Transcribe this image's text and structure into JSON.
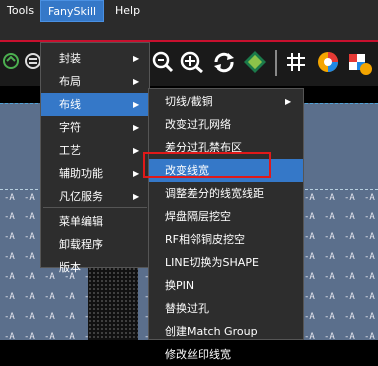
{
  "menubar": {
    "items": [
      "Tools",
      "FanySkill",
      "Help"
    ]
  },
  "menu1": {
    "items": [
      {
        "label": "封装",
        "arrow": "▶"
      },
      {
        "label": "布局",
        "arrow": "▶"
      },
      {
        "label": "布线",
        "arrow": "▶"
      },
      {
        "label": "字符",
        "arrow": "▶"
      },
      {
        "label": "工艺",
        "arrow": "▶"
      },
      {
        "label": "辅助功能",
        "arrow": "▶"
      },
      {
        "label": "凡亿服务",
        "arrow": "▶"
      },
      {
        "label": "菜单编辑",
        "arrow": ""
      },
      {
        "label": "卸载程序",
        "arrow": ""
      },
      {
        "label": "版本",
        "arrow": ""
      }
    ]
  },
  "menu2": {
    "items": [
      {
        "label": "切线/截铜",
        "arrow": "▶"
      },
      {
        "label": "改变过孔网络",
        "arrow": ""
      },
      {
        "label": "差分过孔禁布区",
        "arrow": ""
      },
      {
        "label": "改变线宽",
        "arrow": ""
      },
      {
        "label": "调整差分的线宽线距",
        "arrow": ""
      },
      {
        "label": "焊盘隔层挖空",
        "arrow": ""
      },
      {
        "label": "RF相邻铜皮挖空",
        "arrow": ""
      },
      {
        "label": "LINE切换为SHAPE",
        "arrow": ""
      },
      {
        "label": "换PIN",
        "arrow": ""
      },
      {
        "label": "替换过孔",
        "arrow": ""
      },
      {
        "label": "创建Match Group",
        "arrow": ""
      },
      {
        "label": "修改丝印线宽",
        "arrow": ""
      }
    ]
  },
  "canvas": {
    "pin_label": "-A"
  },
  "colors": {
    "menu_highlight": "#3578c8",
    "menu_bg": "#2d2d2d",
    "highlight_box": "#e01919",
    "accent_red": "#c8102e"
  }
}
